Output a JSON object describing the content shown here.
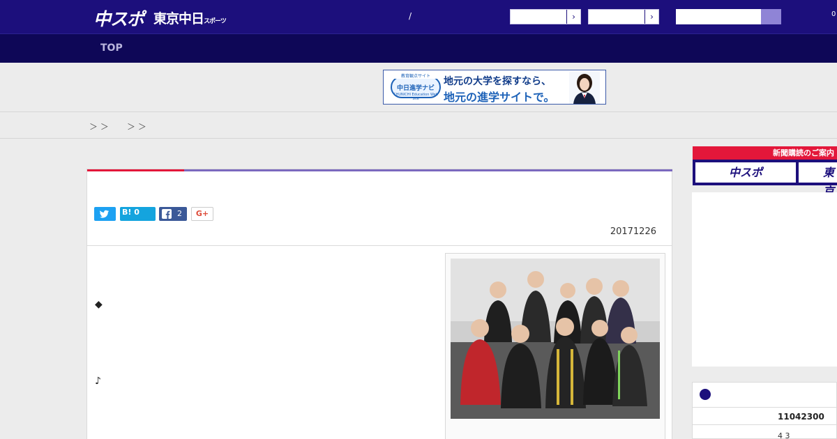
{
  "header": {
    "logo_primary": "中スポ",
    "logo_secondary": "東京中日",
    "logo_secondary_small": "スポーツ",
    "slash": "/",
    "count": "0",
    "accent_color": "#1c0f7c"
  },
  "nav": {
    "top_label": "TOP"
  },
  "banner": {
    "badge_top": "教育観点サイト",
    "badge_main": "中日進学ナビ",
    "badge_sub": "CHUNICHI Education Web Site",
    "line1": "地元の大学を探すなら、",
    "line2": "地元の進学サイトで。"
  },
  "breadcrumb": {
    "sep1": "＞ ＞",
    "sep2": "＞ ＞"
  },
  "article": {
    "hatena_label": "B! 0",
    "facebook_count": "2",
    "gplus_label": "G+",
    "date": "20171226",
    "para_diamond": "◆",
    "para_note": "♪"
  },
  "side": {
    "ad_header": "新聞購読のご案内",
    "ad_btn1": "中スポ",
    "ad_btn2": "東京",
    "score_row1": "11042300",
    "score_row2": "4   3"
  }
}
